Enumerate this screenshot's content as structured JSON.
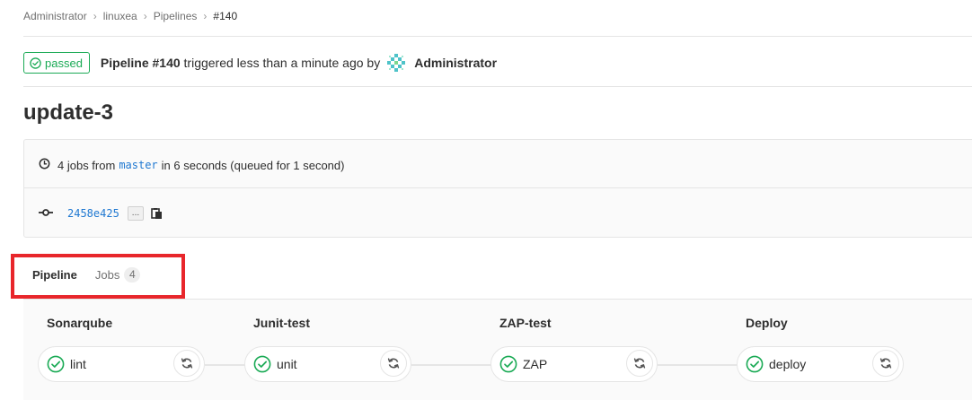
{
  "breadcrumb": {
    "items": [
      {
        "label": "Administrator"
      },
      {
        "label": "linuxea"
      },
      {
        "label": "Pipelines"
      },
      {
        "label": "#140"
      }
    ]
  },
  "header": {
    "status_label": "passed",
    "pipeline_label": "Pipeline #140",
    "triggered_text": "triggered less than a minute ago by",
    "author": "Administrator"
  },
  "title": "update-3",
  "info": {
    "jobs_text": "4 jobs from",
    "branch": "master",
    "duration_text": "in 6 seconds (queued for 1 second)",
    "commit_sha": "2458e425",
    "ellipsis": "..."
  },
  "tabs": {
    "pipeline": "Pipeline",
    "jobs": "Jobs",
    "jobs_count": "4"
  },
  "stages": [
    {
      "name": "Sonarqube",
      "job": "lint",
      "status": "passed"
    },
    {
      "name": "Junit-test",
      "job": "unit",
      "status": "passed"
    },
    {
      "name": "ZAP-test",
      "job": "ZAP",
      "status": "passed"
    },
    {
      "name": "Deploy",
      "job": "deploy",
      "status": "passed"
    }
  ],
  "colors": {
    "success": "#1aaa55",
    "link": "#1f78d1",
    "highlight": "#e8262b"
  },
  "icons": {
    "status": "check-circle-icon",
    "clock": "clock-icon",
    "commit": "commit-icon",
    "copy": "clipboard-icon",
    "retry": "retry-icon",
    "avatar": "identicon-avatar"
  }
}
